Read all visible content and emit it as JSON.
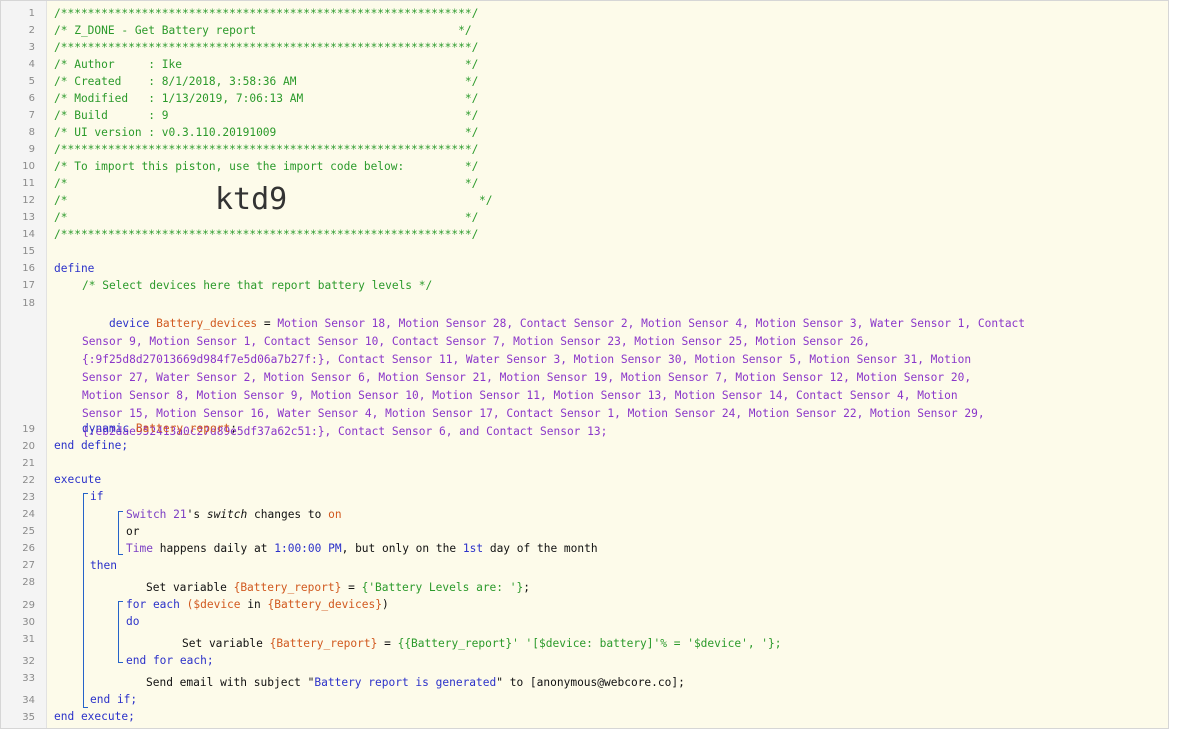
{
  "header": {
    "border": "/*************************************************************/",
    "title": "/* Z_DONE - Get Battery report                              */",
    "author": "/* Author     : Ike                                          */",
    "created": "/* Created    : 8/1/2018, 3:58:36 AM                         */",
    "modified": "/* Modified   : 1/13/2019, 7:06:13 AM                        */",
    "build": "/* Build      : 9                                            */",
    "ui": "/* UI version : v0.3.110.20191009                            */",
    "import_line": "/* To import this piston, use the import code below:         */",
    "blank_line": "/*                                                           */",
    "code_prefix": "/*             ",
    "import_code": "ktd9",
    "code_suffix": "                          */"
  },
  "define": {
    "kw_define": "define",
    "comment": "/* Select devices here that report battery levels */",
    "kw_device": "device",
    "var_devices": "Battery_devices",
    "line18": [
      "Motion Sensor 18, Motion Sensor 28, Contact Sensor 2, Motion Sensor 4, Motion Sensor 3, Water Sensor 1, Contact",
      "Sensor 9, Motion Sensor 1, Contact Sensor 10, Contact Sensor 7, Motion Sensor 23, Motion Sensor 25, Motion Sensor 26,",
      "{:9f25d8d27013669d984f7e5d06a7b27f:}, Contact Sensor 11, Water Sensor 3, Motion Sensor 30, Motion Sensor 5, Motion Sensor 31, Motion",
      "Sensor 27, Water Sensor 2, Motion Sensor 6, Motion Sensor 21, Motion Sensor 19, Motion Sensor 7, Motion Sensor 12, Motion Sensor 20,",
      "Motion Sensor 8, Motion Sensor 9, Motion Sensor 10, Motion Sensor 11, Motion Sensor 13, Motion Sensor 14, Contact Sensor 4, Motion",
      "Sensor 15, Motion Sensor 16, Water Sensor 4, Motion Sensor 17, Contact Sensor 1, Motion Sensor 24, Motion Sensor 22, Motion Sensor 29,",
      "{:eb2dae952413a0c27d89e5df37a62c51:}, Contact Sensor 6, and Contact Sensor 13;"
    ],
    "kw_dynamic": "dynamic",
    "var_report": "Battery_report",
    "kw_end_define": "end define;"
  },
  "execute": {
    "kw_execute": "execute",
    "kw_if": "if",
    "cond1_device": "Switch 21",
    "cond1_attr": "switch",
    "cond1_op": "changes to",
    "cond1_value": "on",
    "kw_or": "or",
    "cond2_device": "Time",
    "cond2_text": "happens daily at",
    "cond2_time": "1:00:00 PM",
    "cond2_text2": ", but only on the",
    "cond2_day": "1st",
    "cond2_text3": "day of the month",
    "kw_then": "then",
    "set1_text": "Set variable",
    "set1_var": "{Battery_report}",
    "set1_eq": " = ",
    "set1_val": "{'Battery Levels are: '}",
    "kw_for_each": "for each",
    "for_var": "($device",
    "for_in": " in ",
    "for_list": "{Battery_devices}",
    "kw_do": "do",
    "set2_text": "Set variable",
    "set2_var": "{Battery_report}",
    "set2_eq": " = ",
    "set2_val": "{{Battery_report}' '[$device: battery]'% = '$device', '};",
    "kw_end_for": "end for each;",
    "email_text": "Send email with subject \"",
    "email_subject": "Battery report is generated",
    "email_to": "\" to [anonymous@webcore.co];",
    "kw_end_if": "end if;",
    "kw_end_execute": "end execute;"
  },
  "line_numbers": [
    "1",
    "2",
    "3",
    "4",
    "5",
    "6",
    "7",
    "8",
    "9",
    "10",
    "11",
    "12",
    "13",
    "14",
    "15",
    "16",
    "17",
    "18",
    "19",
    "20",
    "21",
    "22",
    "23",
    "24",
    "25",
    "26",
    "27",
    "28",
    "29",
    "30",
    "31",
    "32",
    "33",
    "34",
    "35"
  ]
}
